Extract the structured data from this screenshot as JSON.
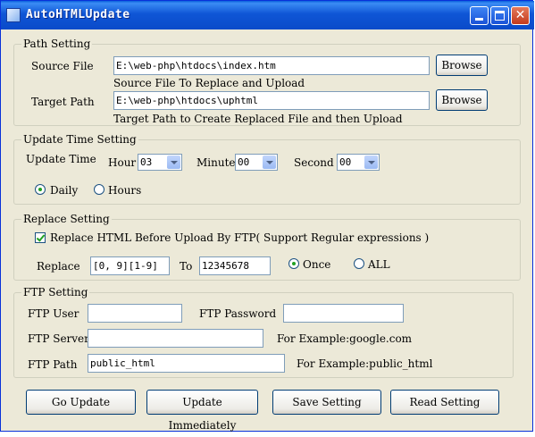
{
  "window": {
    "title": "AutoHTMLUpdate"
  },
  "path_setting": {
    "legend": "Path Setting",
    "source_label": "Source File",
    "source_value": "E:\\web-php\\htdocs\\index.htm",
    "source_hint": "Source File To Replace and Upload",
    "target_label": "Target Path",
    "target_value": "E:\\web-php\\htdocs\\uphtml",
    "target_hint": "Target Path to Create Replaced File and then Upload",
    "browse_label": "Browse"
  },
  "update_time": {
    "legend": "Update Time Setting",
    "label": "Update Time",
    "hour_label": "Hour",
    "hour_value": "03",
    "minute_label": "Minute",
    "minute_value": "00",
    "second_label": "Second",
    "second_value": "00",
    "daily_label": "Daily",
    "hours_label": "Hours",
    "selected": "Daily"
  },
  "replace_setting": {
    "legend": "Replace Setting",
    "checkbox_label": "Replace HTML Before Upload By FTP( Support Regular expressions )",
    "checked": true,
    "replace_label": "Replace",
    "replace_value": "[0, 9][1-9]",
    "to_label": "To",
    "to_value": "12345678",
    "once_label": "Once",
    "all_label": "ALL",
    "selected": "Once"
  },
  "ftp_setting": {
    "legend": "FTP Setting",
    "user_label": "FTP User",
    "user_value": "",
    "password_label": "FTP Password",
    "password_value": "",
    "server_label": "FTP Server",
    "server_value": "",
    "server_example": "For Example:google.com",
    "path_label": "FTP Path",
    "path_value": "public_html",
    "path_example": "For Example:public_html"
  },
  "buttons": {
    "go_update": "Go Update",
    "update_immediately": "Update Immediately",
    "save_setting": "Save Setting",
    "read_setting": "Read Setting"
  }
}
